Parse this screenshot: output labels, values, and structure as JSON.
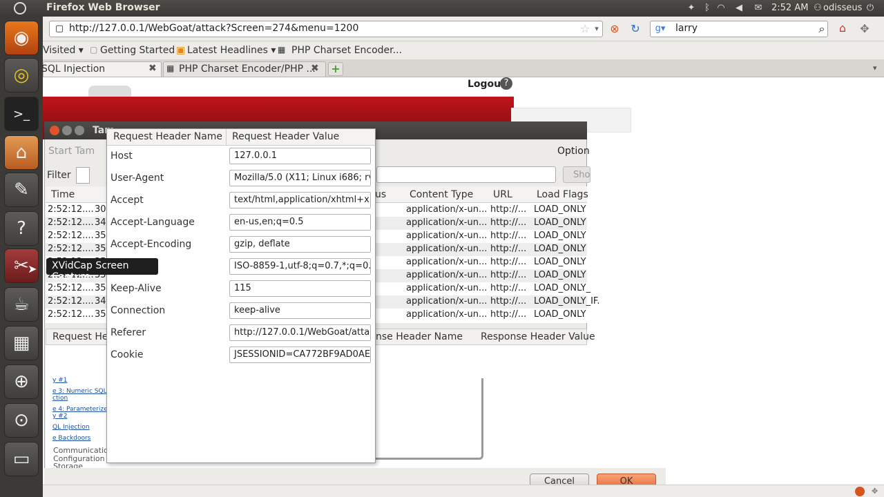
{
  "panel": {
    "title": "Firefox Web Browser",
    "clock": "2:52 AM",
    "user": "odisseus"
  },
  "browser": {
    "url": "http://127.0.0.1/WebGoat/attack?Screen=274&menu=1200",
    "search": "larry",
    "bookmarks": [
      "Visited ▾",
      "Getting Started",
      "Latest Headlines ▾",
      "PHP Charset Encoder..."
    ],
    "tabs": [
      {
        "label": "SQL Injection"
      },
      {
        "label": "PHP Charset Encoder/PHP ..."
      }
    ]
  },
  "page": {
    "logout": "Logout",
    "help": "?",
    "links": [
      "y #1",
      "e 3: Numeric SQL",
      "ction",
      "e 4: Parameterized",
      "y #2",
      "QL Injection",
      "e Backdoors"
    ],
    "texts": [
      "Communication",
      "Configuration",
      "Storage"
    ]
  },
  "tamper": {
    "title": "Tam",
    "start": "Start Tam",
    "options": "Option",
    "filter_label": "Filter",
    "show_label": "Sho",
    "columns": [
      "Time",
      "us",
      "Content Type",
      "URL",
      "Load Flags"
    ],
    "rows": [
      {
        "time": "2:52:12....",
        "num": "30",
        "type": "application/x-un...",
        "url": "http://...",
        "flags": "LOAD_ONLY"
      },
      {
        "time": "2:52:12....",
        "num": "34",
        "type": "application/x-un...",
        "url": "http://...",
        "flags": "LOAD_ONLY"
      },
      {
        "time": "2:52:12....",
        "num": "35",
        "type": "application/x-un...",
        "url": "http://...",
        "flags": "LOAD_ONLY"
      },
      {
        "time": "2:52:12....",
        "num": "35",
        "type": "application/x-un...",
        "url": "http://...",
        "flags": "LOAD_ONLY"
      },
      {
        "time": "2:52:12....",
        "num": "35",
        "type": "application/x-un...",
        "url": "http://...",
        "flags": "LOAD_ONLY"
      },
      {
        "time": "2:52:12....",
        "num": "35",
        "type": "application/x-un...",
        "url": "http://...",
        "flags": "LOAD_ONLY"
      },
      {
        "time": "2:52:12....",
        "num": "35",
        "type": "application/x-un...",
        "url": "http://...",
        "flags": "LOAD_ONLY_"
      },
      {
        "time": "2:52:12....",
        "num": "34",
        "type": "application/x-un...",
        "url": "http://...",
        "flags": "LOAD_ONLY_IF."
      },
      {
        "time": "2:52:12....",
        "num": "35",
        "type": "application/x-un...",
        "url": "http://...",
        "flags": "LOAD_ONLY"
      }
    ],
    "lower_columns": [
      "Request Hea",
      "nse Header Name",
      "Response Header Value"
    ],
    "cancel": "Cancel",
    "ok": "OK"
  },
  "headers_dialog": {
    "col_name": "Request Header Name",
    "col_value": "Request Header Value",
    "rows": [
      {
        "name": "Host",
        "value": "127.0.0.1"
      },
      {
        "name": "User-Agent",
        "value": "Mozilla/5.0 (X11; Linux i686; rv:"
      },
      {
        "name": "Accept",
        "value": "text/html,application/xhtml+x"
      },
      {
        "name": "Accept-Language",
        "value": "en-us,en;q=0.5"
      },
      {
        "name": "Accept-Encoding",
        "value": "gzip, deflate"
      },
      {
        "name": "rset",
        "value": "ISO-8859-1,utf-8;q=0.7,*;q=0.7"
      },
      {
        "name": "Keep-Alive",
        "value": "115"
      },
      {
        "name": "Connection",
        "value": "keep-alive"
      },
      {
        "name": "Referer",
        "value": "http://127.0.0.1/WebGoat/atta"
      },
      {
        "name": "Cookie",
        "value": "JSESSIONID=CA772BF9AD0AEI"
      }
    ]
  },
  "tooltip": "XVidCap Screen Capture"
}
